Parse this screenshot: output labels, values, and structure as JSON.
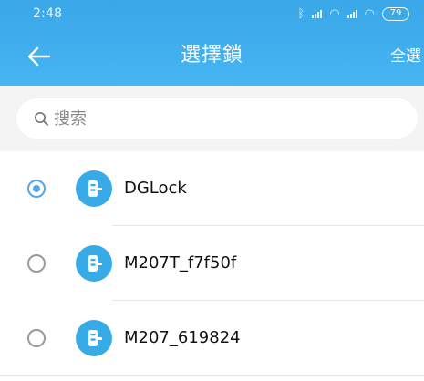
{
  "status_bar": {
    "time": "2:48",
    "battery": "79"
  },
  "header": {
    "title": "選擇鎖",
    "select_all": "全選"
  },
  "search": {
    "placeholder": "搜索",
    "value": ""
  },
  "devices": [
    {
      "name": "DGLock",
      "selected": true
    },
    {
      "name": "M207T_f7f50f",
      "selected": false
    },
    {
      "name": "M207_619824",
      "selected": false
    }
  ],
  "colors": {
    "header": "#3aa7e8",
    "accent": "#38abe6",
    "background": "#f4f4f4"
  },
  "icons": {
    "back": "back-arrow-icon",
    "search": "search-icon",
    "lock": "door-lock-icon",
    "bluetooth": "bluetooth-icon",
    "wifi": "wifi-icon",
    "signal": "signal-icon",
    "battery": "battery-icon"
  }
}
